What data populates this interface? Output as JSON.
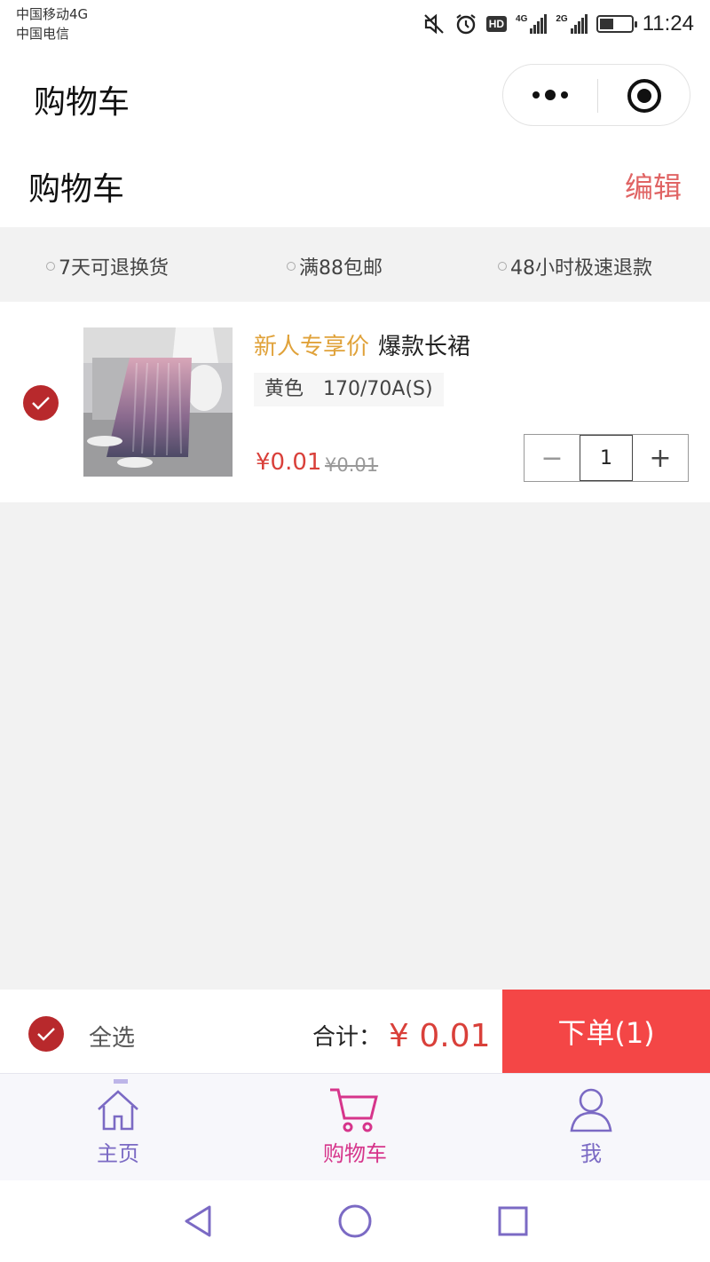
{
  "status_bar": {
    "carrier1": "中国移动4G",
    "carrier2": "中国电信",
    "sim1_label": "4G",
    "sim2_label": "2G",
    "hd": "HD",
    "time": "11:24",
    "battery_level": 0.4
  },
  "navbar": {
    "title": "购物车"
  },
  "page": {
    "title": "购物车",
    "edit_label": "编辑"
  },
  "services": [
    "7天可退换货",
    "满88包邮",
    "48小时极速退款"
  ],
  "cart_item": {
    "selected": true,
    "promo_tag": "新人专享价",
    "name": "爆款长裙",
    "spec_color": "黄色",
    "spec_size": "170/70A(S)",
    "price": "¥0.01",
    "original_price": "¥0.01",
    "quantity": "1",
    "minus_symbol": "−",
    "plus_symbol": "+"
  },
  "footer": {
    "select_all_label": "全选",
    "total_label": "合计：",
    "total_amount": "¥ 0.01",
    "order_button": "下单(1)"
  },
  "tabs": [
    {
      "label": "主页",
      "icon": "home-icon"
    },
    {
      "label": "购物车",
      "icon": "cart-icon",
      "active": true
    },
    {
      "label": "我",
      "icon": "user-icon"
    }
  ],
  "colors": {
    "accent_red": "#f44646",
    "price_red": "#d9403a",
    "check_red": "#b8292c",
    "promo_orange": "#e0a23a",
    "tab_active": "#d6358b",
    "tab_inactive": "#7b6ac4"
  }
}
